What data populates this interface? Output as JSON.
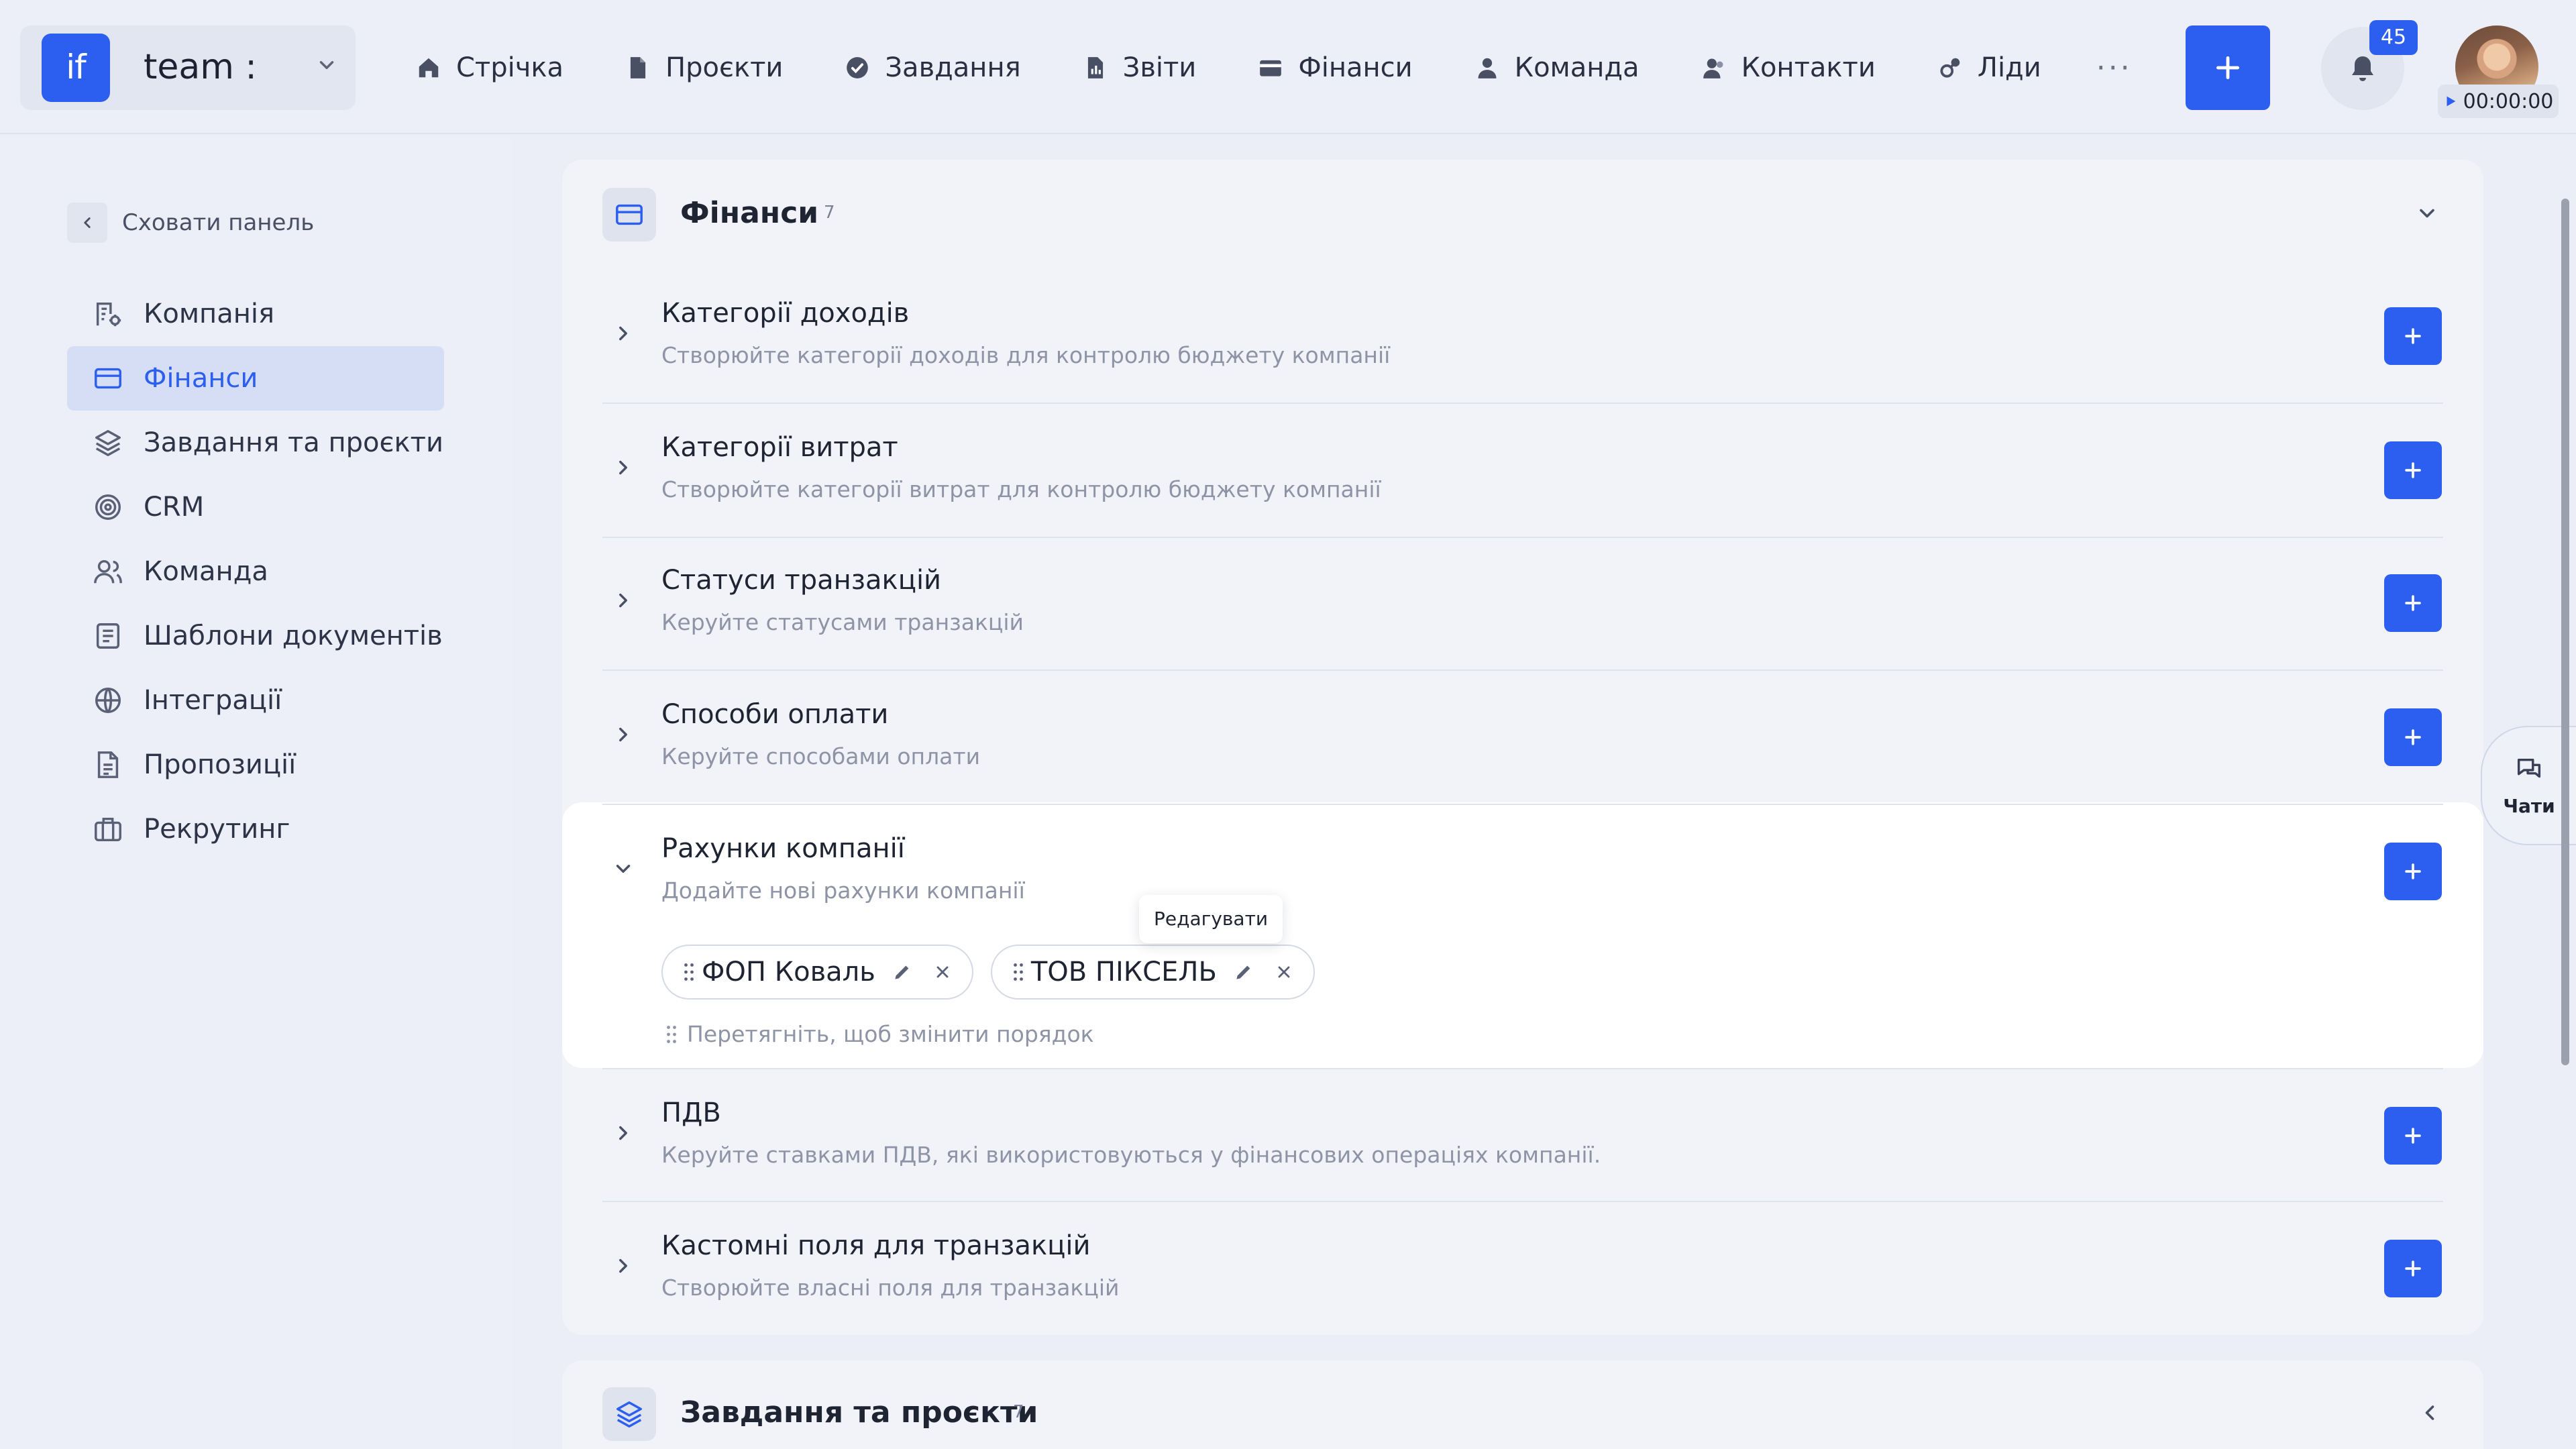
{
  "topbar": {
    "workspace": {
      "logo": "if",
      "name": "team :"
    },
    "nav": [
      {
        "label": "Стрічка",
        "icon": "home-icon"
      },
      {
        "label": "Проєкти",
        "icon": "file-icon"
      },
      {
        "label": "Завдання",
        "icon": "check-circle-icon"
      },
      {
        "label": "Звіти",
        "icon": "chart-icon"
      },
      {
        "label": "Фінанси",
        "icon": "wallet-icon"
      },
      {
        "label": "Команда",
        "icon": "user-icon"
      },
      {
        "label": "Контакти",
        "icon": "contacts-icon"
      },
      {
        "label": "Ліди",
        "icon": "leads-icon"
      }
    ],
    "more": "···",
    "notifications_count": "45",
    "timer": "00:00:00"
  },
  "sidebar": {
    "hide_label": "Сховати панель",
    "items": [
      {
        "label": "Компанія",
        "icon": "company-icon"
      },
      {
        "label": "Фінанси",
        "icon": "card-icon",
        "active": true
      },
      {
        "label": "Завдання та проєкти",
        "icon": "layers-icon"
      },
      {
        "label": "CRM",
        "icon": "target-icon"
      },
      {
        "label": "Команда",
        "icon": "team-icon"
      },
      {
        "label": "Шаблони документів",
        "icon": "document-template-icon"
      },
      {
        "label": "Інтеграції",
        "icon": "globe-icon"
      },
      {
        "label": "Пропозиції",
        "icon": "proposal-icon"
      },
      {
        "label": "Рекрутинг",
        "icon": "briefcase-icon"
      }
    ]
  },
  "finance_section": {
    "title": "Фінанси",
    "count": "7",
    "rows": [
      {
        "title": "Категорії доходів",
        "desc": "Створюйте категорії доходів для контролю бюджету компанії"
      },
      {
        "title": "Категорії витрат",
        "desc": "Створюйте категорії витрат для контролю бюджету компанії"
      },
      {
        "title": "Статуси транзакцій",
        "desc": "Керуйте статусами транзакцій"
      },
      {
        "title": "Способи оплати",
        "desc": "Керуйте способами оплати"
      },
      {
        "title": "Рахунки компанії",
        "desc": "Додайте нові рахунки компанії",
        "expanded": true
      },
      {
        "title": "ПДВ",
        "desc": "Керуйте ставками ПДВ, які використовуються у фінансових операціях компанії."
      },
      {
        "title": "Кастомні поля для транзакцій",
        "desc": "Створюйте власні поля для транзакцій"
      }
    ],
    "accounts": [
      "ФОП Коваль",
      "ТОВ ПІКСЕЛЬ"
    ],
    "tooltip": "Редагувати",
    "drag_hint": "Перетягніть, щоб змінити порядок"
  },
  "tasks_section": {
    "title": "Завдання та проєкти",
    "count": "7"
  },
  "chats_label": "Чати",
  "colors": {
    "accent": "#2c5ff0",
    "page_bg": "#ebeef6"
  }
}
